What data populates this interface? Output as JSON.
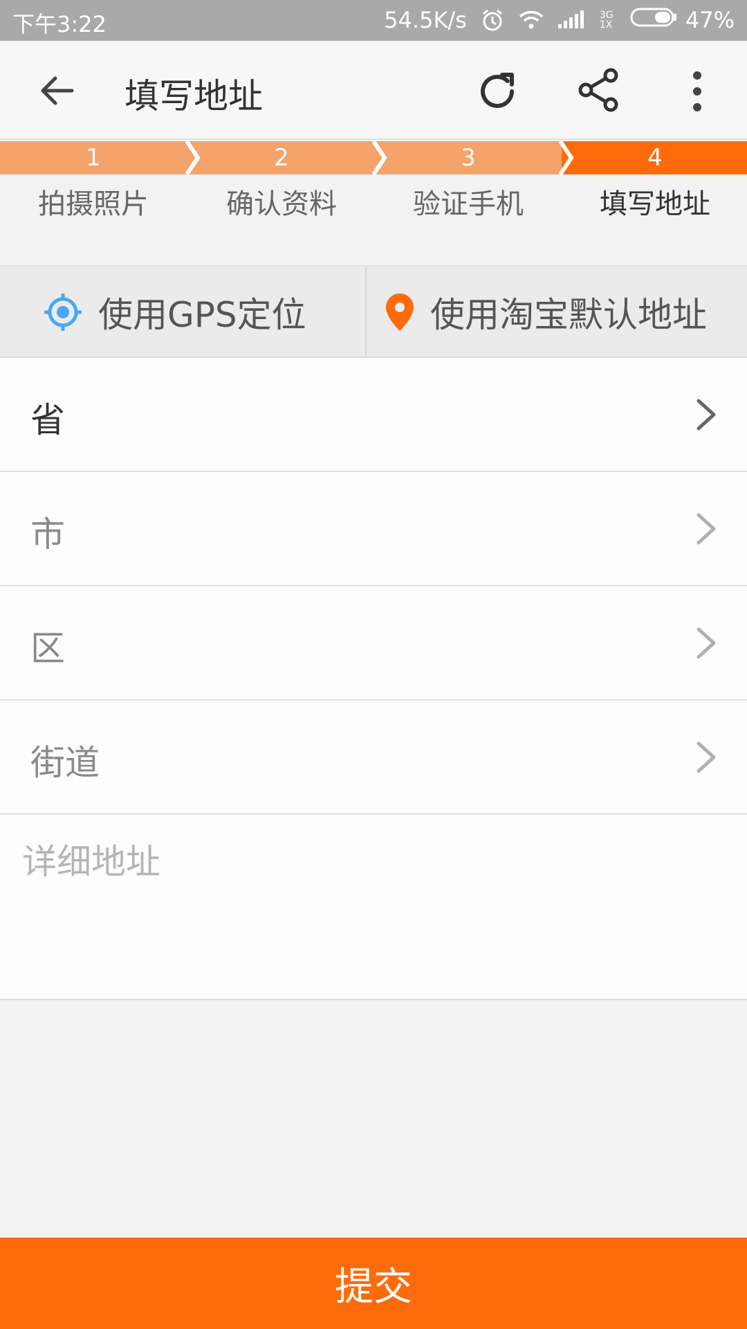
{
  "status_bar": {
    "time": "下午3:22",
    "speed": "54.5K/s",
    "network": "3G 1X",
    "battery": "47%"
  },
  "app_bar": {
    "title": "填写地址",
    "icons": [
      "back-arrow-icon",
      "refresh-icon",
      "share-icon",
      "more-vertical-icon"
    ]
  },
  "steps": [
    {
      "number": "1",
      "label": "拍摄照片",
      "active": false
    },
    {
      "number": "2",
      "label": "确认资料",
      "active": false
    },
    {
      "number": "3",
      "label": "验证手机",
      "active": false
    },
    {
      "number": "4",
      "label": "填写地址",
      "active": true
    }
  ],
  "location_options": {
    "gps": "使用GPS定位",
    "taobao": "使用淘宝默认地址"
  },
  "form": {
    "province": "省",
    "city": "市",
    "district": "区",
    "street": "街道",
    "detail_placeholder": "详细地址"
  },
  "submit_label": "提交",
  "colors": {
    "accent": "#ff6a0a",
    "step_inactive": "#f4a36a",
    "gps_icon": "#4aa8f5",
    "pin_icon": "#ff6a0a"
  }
}
